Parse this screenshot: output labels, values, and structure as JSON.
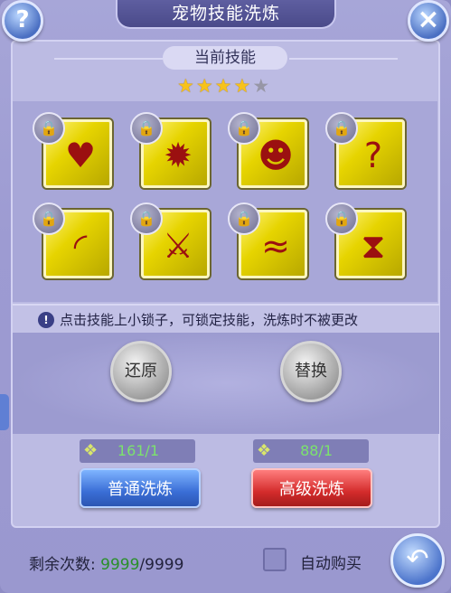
{
  "window": {
    "title": "宠物技能洗炼"
  },
  "header": {
    "current_skills_label": "当前技能"
  },
  "rating": {
    "value": 4,
    "max": 5
  },
  "skills": [
    {
      "icon": "heart-charm-icon",
      "glyph": "♥"
    },
    {
      "icon": "flame-burst-icon",
      "glyph": "✹"
    },
    {
      "icon": "head-aura-icon",
      "glyph": "☻"
    },
    {
      "icon": "mystery-head-icon",
      "glyph": "?"
    },
    {
      "icon": "arc-wave-icon",
      "glyph": "◜"
    },
    {
      "icon": "crossed-swords-icon",
      "glyph": "⚔"
    },
    {
      "icon": "lizard-icon",
      "glyph": "≈"
    },
    {
      "icon": "hourglass-shield-icon",
      "glyph": "⧗"
    }
  ],
  "info": {
    "text": "点击技能上小锁子，可锁定技能，洗炼时不被更改"
  },
  "actions": {
    "restore_label": "还原",
    "replace_label": "替换"
  },
  "resources": {
    "normal_count": "161/1",
    "advanced_count": "88/1"
  },
  "wash": {
    "normal_label": "普通洗炼",
    "advanced_label": "高级洗炼"
  },
  "footer": {
    "remain_label": "剩余次数:",
    "remain_current": "9999",
    "remain_total": "/9999",
    "auto_buy_label": "自动购买"
  },
  "colors": {
    "accent_green": "#2a8f2a",
    "normal_btn": "#3a6ed6",
    "advanced_btn": "#d42c2c",
    "skill_bg": "#e6d400"
  }
}
